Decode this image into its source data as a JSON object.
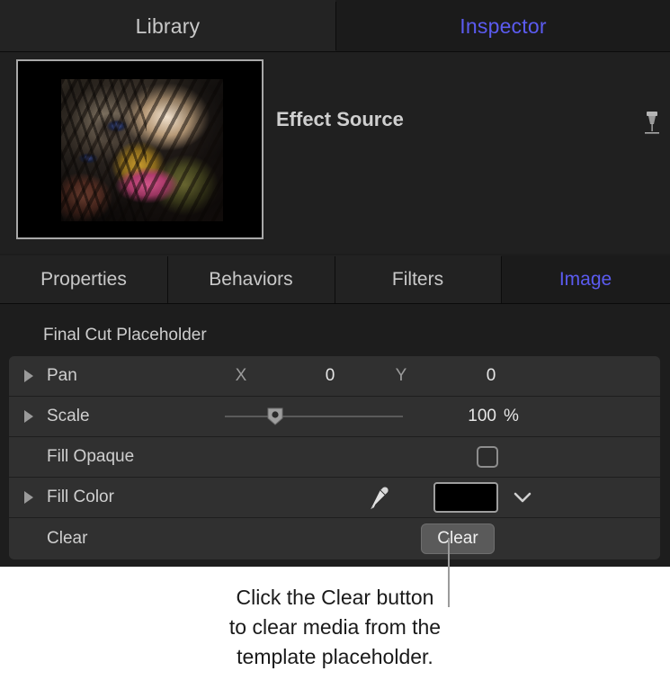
{
  "top_tabs": [
    {
      "label": "Library",
      "active": false
    },
    {
      "label": "Inspector",
      "active": true
    }
  ],
  "source_header": {
    "title": "Effect Source",
    "pin_icon": "pushpin-icon",
    "thumbnail_alt": "cat-close-up-thumbnail"
  },
  "inspector_tabs": [
    {
      "label": "Properties",
      "active": false
    },
    {
      "label": "Behaviors",
      "active": false
    },
    {
      "label": "Filters",
      "active": false
    },
    {
      "label": "Image",
      "active": true
    }
  ],
  "section": {
    "title": "Final Cut Placeholder"
  },
  "parameters": {
    "pan": {
      "label": "Pan",
      "x_axis_label": "X",
      "x_value": "0",
      "y_axis_label": "Y",
      "y_value": "0"
    },
    "scale": {
      "label": "Scale",
      "value": "100",
      "unit": "%",
      "slider_percent": 25
    },
    "fill_opaque": {
      "label": "Fill Opaque",
      "checked": false
    },
    "fill_color": {
      "label": "Fill Color",
      "eyedropper_icon": "eyedropper-icon",
      "swatch_color": "#000000",
      "chevron_icon": "chevron-down-icon"
    },
    "clear": {
      "label": "Clear",
      "button_label": "Clear"
    }
  },
  "callout": {
    "line1": "Click the Clear button",
    "line2": "to clear media from the",
    "line3": "template placeholder."
  },
  "colors": {
    "accent": "#5b5bf0",
    "panel_bg": "#1d1d1d",
    "row_bg": "#303030",
    "text": "#cfcfcf"
  }
}
